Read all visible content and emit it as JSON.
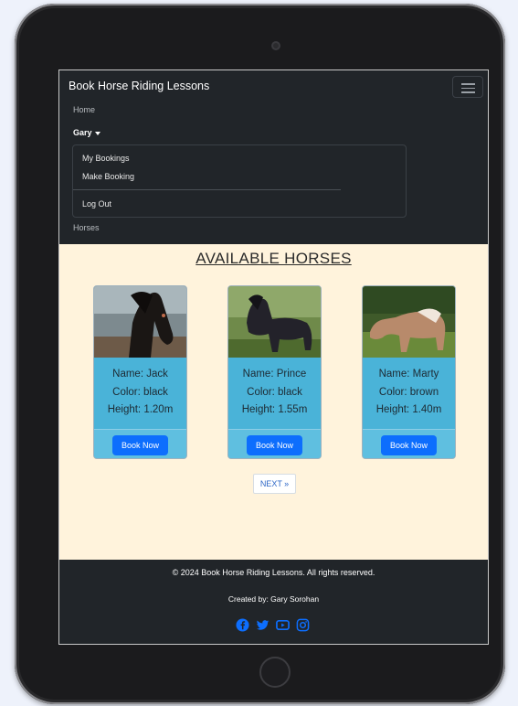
{
  "navbar": {
    "brand": "Book Horse Riding Lessons",
    "home": "Home",
    "user": "Gary",
    "dropdown": [
      "My Bookings",
      "Make Booking",
      "Log Out"
    ],
    "horses": "Horses"
  },
  "main": {
    "heading": "AVAILABLE HORSES",
    "horses": [
      {
        "name": "Name: Jack",
        "color": "Color: black",
        "height": "Height: 1.20m",
        "button": "Book Now",
        "coat": "#1a1614"
      },
      {
        "name": "Name: Prince",
        "color": "Color: black",
        "height": "Height: 1.55m",
        "button": "Book Now",
        "coat": "#23222a"
      },
      {
        "name": "Name: Marty",
        "color": "Color: brown",
        "height": "Height: 1.40m",
        "button": "Book Now",
        "coat": "#b88a6b"
      }
    ],
    "next": "NEXT »"
  },
  "footer": {
    "copyright": "© 2024 Book Horse Riding Lessons. All rights reserved.",
    "creator": "Created by: Gary Sorohan",
    "socials": [
      "facebook-icon",
      "twitter-icon",
      "youtube-icon",
      "instagram-icon"
    ]
  },
  "colors": {
    "navbar": "#212529",
    "main_bg": "#fff3dc",
    "card": "#4ab3d8",
    "button": "#0d6efd",
    "social": "#0d6efd"
  }
}
